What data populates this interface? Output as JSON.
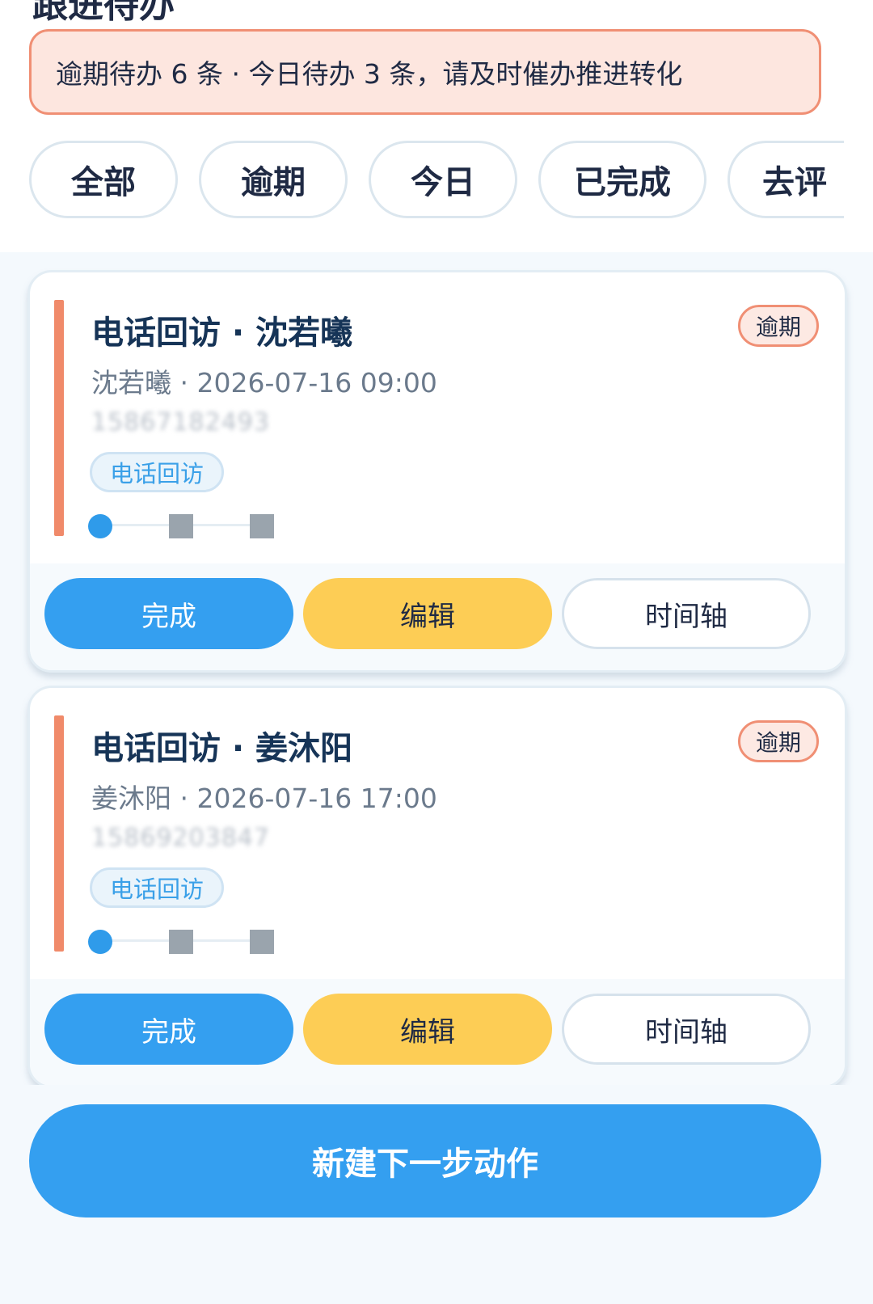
{
  "header": {
    "title_partial": "跟进待办"
  },
  "alert": {
    "text": "逾期待办 6 条 · 今日待办 3 条，请及时催办推进转化"
  },
  "filters": [
    {
      "label": "全部"
    },
    {
      "label": "逾期"
    },
    {
      "label": "今日"
    },
    {
      "label": "已完成"
    },
    {
      "label": "去评"
    }
  ],
  "cards": [
    {
      "title": "电话回访 · 沈若曦",
      "status": "逾期",
      "meta": "沈若曦 · 2026-07-16 09:00",
      "phone": "15867182493",
      "tag": "电话回访",
      "progress_step": 1,
      "progress_total": 3,
      "actions": {
        "complete": "完成",
        "edit": "编辑",
        "timeline": "时间轴"
      }
    },
    {
      "title": "电话回访 · 姜沐阳",
      "status": "逾期",
      "meta": "姜沐阳 · 2026-07-16 17:00",
      "phone": "15869203847",
      "tag": "电话回访",
      "progress_step": 1,
      "progress_total": 3,
      "actions": {
        "complete": "完成",
        "edit": "编辑",
        "timeline": "时间轴"
      }
    }
  ],
  "footer": {
    "new_action_label": "新建下一步动作"
  },
  "colors": {
    "accent_blue": "#349ff0",
    "overdue_orange": "#f08f74",
    "edit_yellow": "#fdcd55",
    "title_navy": "#163457"
  }
}
